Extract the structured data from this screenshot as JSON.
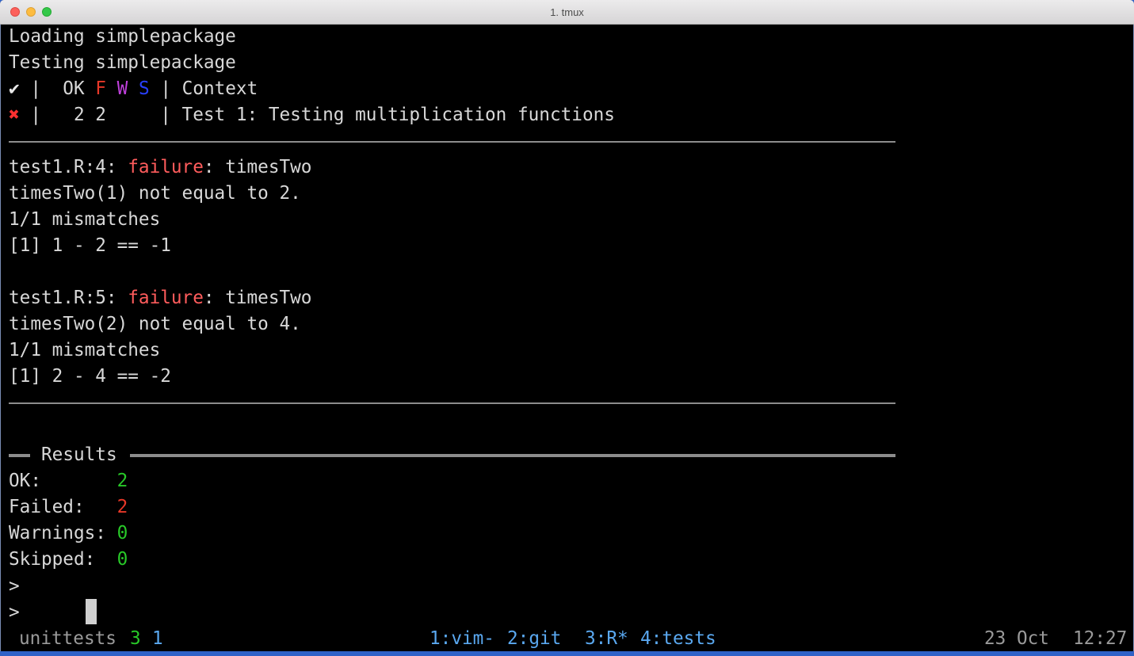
{
  "window": {
    "title": "1. tmux"
  },
  "terminal": {
    "lines": {
      "l1": "Loading simplepackage",
      "l2": "Testing simplepackage",
      "header": {
        "check": "✔",
        "sep1": " |  OK ",
        "f": "F",
        "w": "W",
        "s": "S",
        "sep2": " | Context"
      },
      "row": {
        "cross": "✖",
        "text": " |   2 2     | Test 1: Testing multiplication functions"
      },
      "f1": {
        "loc": "test1.R:4: ",
        "kind": "failure",
        "rest": ": timesTwo"
      },
      "f1a": "timesTwo(1) not equal to 2.",
      "f1b": "1/1 mismatches",
      "f1c": "[1] 1 - 2 == -1",
      "f2": {
        "loc": "test1.R:5: ",
        "kind": "failure",
        "rest": ": timesTwo"
      },
      "f2a": "timesTwo(2) not equal to 4.",
      "f2b": "1/1 mismatches",
      "f2c": "[1] 2 - 4 == -2",
      "results_title": "Results",
      "ok": {
        "label": "OK:       ",
        "value": "2"
      },
      "failed": {
        "label": "Failed:   ",
        "value": "2"
      },
      "warnings": {
        "label": "Warnings: ",
        "value": "0"
      },
      "skipped": {
        "label": "Skipped:  ",
        "value": "0"
      },
      "prompt1": ">",
      "prompt2": ">"
    }
  },
  "statusbar": {
    "session": "unittests",
    "n1": "3",
    "n2": "1",
    "windows": [
      "1:vim-",
      "2:git",
      "3:R*",
      "4:tests"
    ],
    "date": "23 Oct",
    "time": "12:27"
  },
  "colors": {
    "failure": "#ff5c5c",
    "ok": "#28c828",
    "failed": "#e83828",
    "window_list": "#5aa8f0",
    "background": "#000000"
  }
}
